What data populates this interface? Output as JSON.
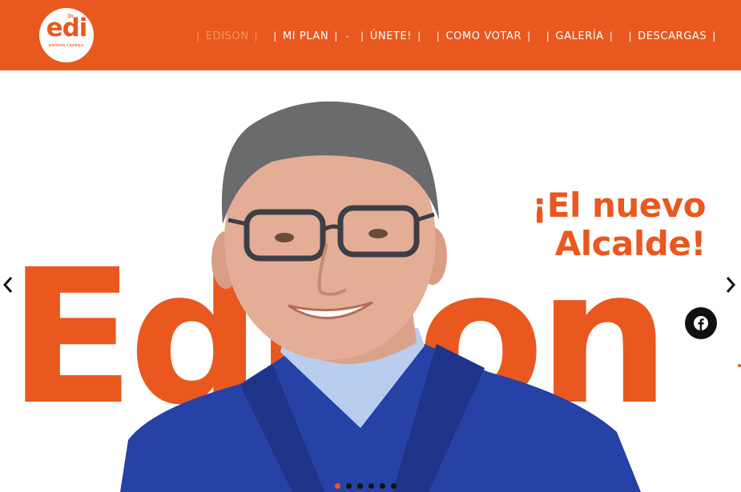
{
  "header": {
    "logo": {
      "prefix": "Dr.",
      "text": "edi",
      "tagline": "EDISON CEPEDA"
    },
    "nav": [
      {
        "label": "EDISON",
        "active": true,
        "has_dropdown": false
      },
      {
        "label": "MI PLAN",
        "active": false,
        "has_dropdown": true
      },
      {
        "label": "ÚNETE!",
        "active": false,
        "has_dropdown": false
      },
      {
        "label": "COMO VOTAR",
        "active": false,
        "has_dropdown": false
      },
      {
        "label": "GALERÍA",
        "active": false,
        "has_dropdown": false
      },
      {
        "label": "DESCARGAS",
        "active": false,
        "has_dropdown": false
      }
    ],
    "separator": "|"
  },
  "hero": {
    "big_name": "Edison",
    "slogan_line1": "¡El nuevo",
    "slogan_line2": "Alcalde!",
    "slider": {
      "total_slides": 6,
      "active_index": 0
    },
    "social_icon": "facebook-icon",
    "prev_icon": "chevron-left-icon",
    "next_icon": "chevron-right-icon"
  },
  "colors": {
    "brand_orange": "#e8581f",
    "active_nav": "#f59a53",
    "white": "#ffffff",
    "dark": "#111111",
    "jacket_blue": "#2742a6",
    "shirt_blue": "#b9cdef"
  }
}
